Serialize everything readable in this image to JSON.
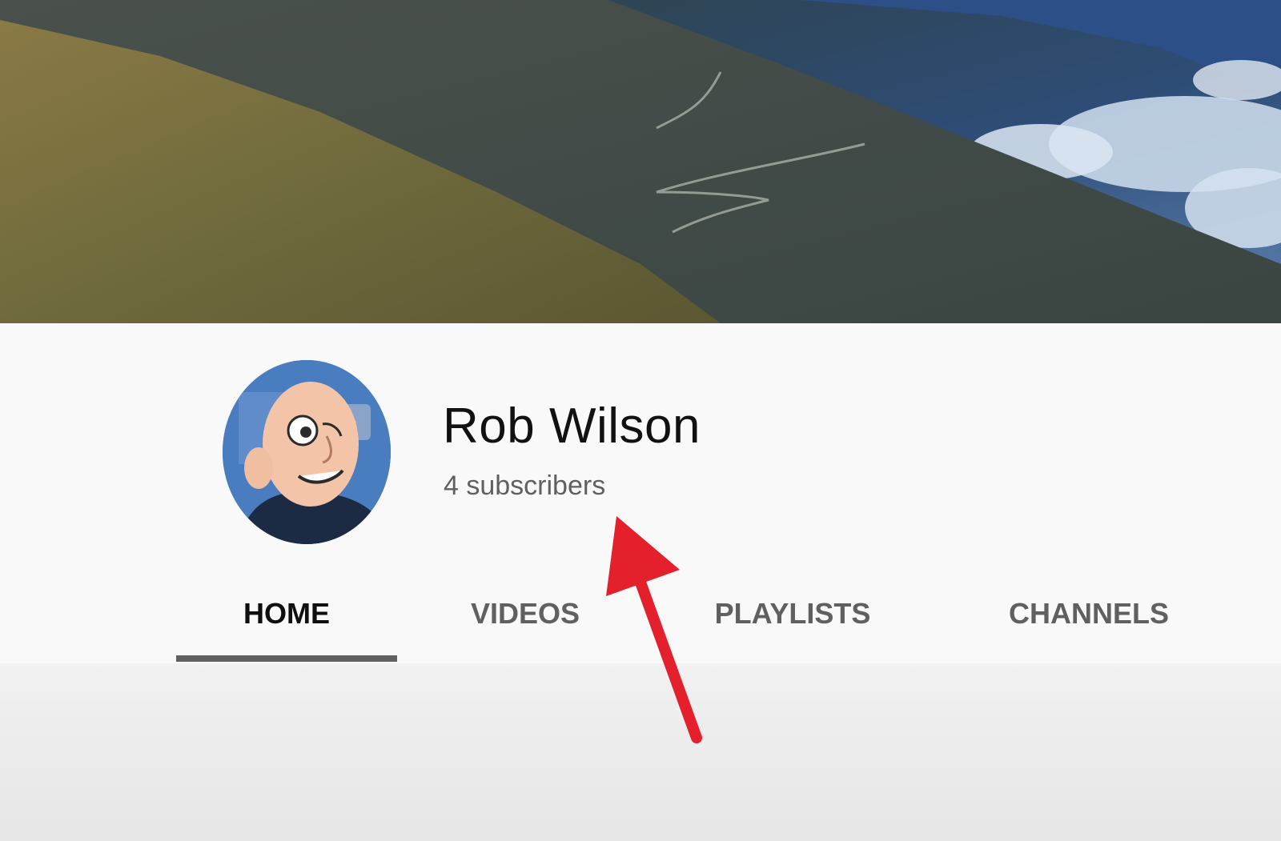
{
  "channel": {
    "name": "Rob Wilson",
    "subscribers": "4 subscribers"
  },
  "tabs": [
    {
      "label": "HOME",
      "active": true
    },
    {
      "label": "VIDEOS",
      "active": false
    },
    {
      "label": "PLAYLISTS",
      "active": false
    },
    {
      "label": "CHANNELS",
      "active": false
    }
  ],
  "colors": {
    "annotation_arrow": "#e3202b",
    "active_tab_underline": "#606060",
    "header_background": "#f9f9f9"
  },
  "icons": {
    "avatar": "cartoon-bald-man-avatar",
    "banner": "mountain-landscape-banner",
    "annotation": "red-arrow-pointing-up"
  }
}
